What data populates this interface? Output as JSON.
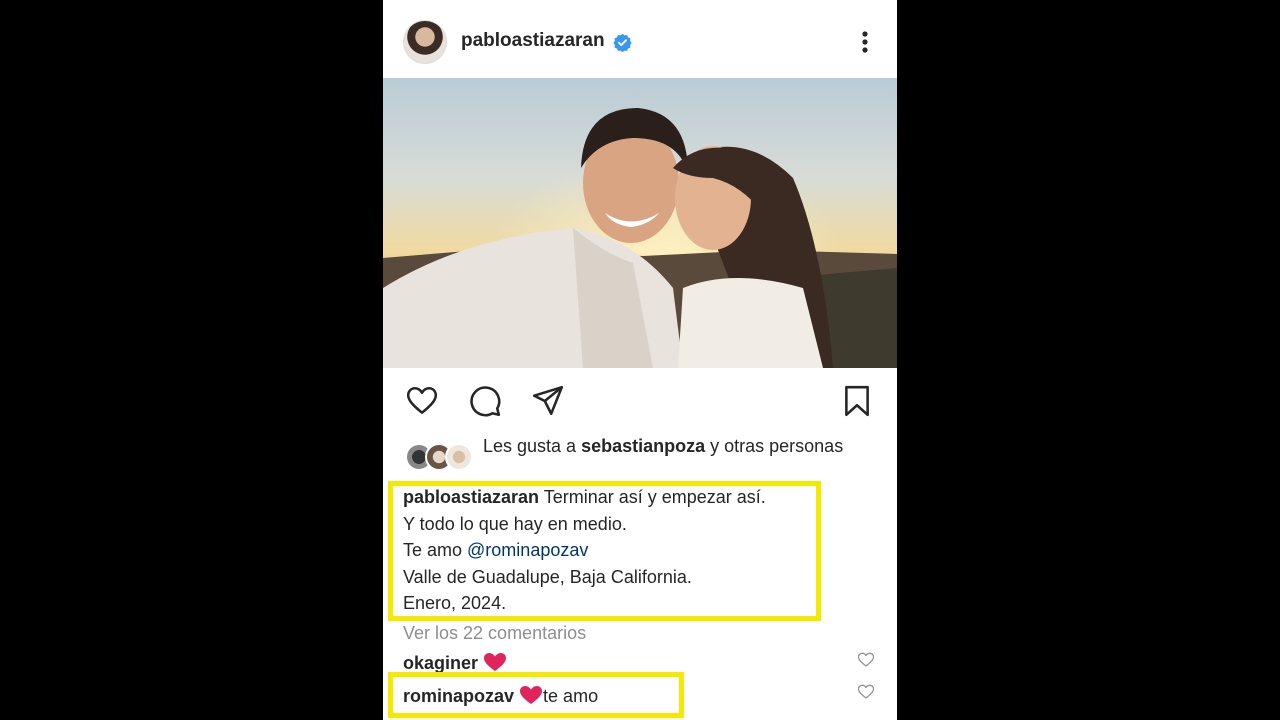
{
  "post": {
    "username": "pabloastiazaran",
    "verified": true
  },
  "likes": {
    "prefix": "Les gusta a ",
    "user": "sebastianpoza",
    "suffix": " y otras personas"
  },
  "caption": {
    "username": "pabloastiazaran",
    "line1": " Terminar así y empezar así.",
    "line2": "Y todo lo que hay en medio.",
    "line3_prefix": "Te amo ",
    "mention": "@rominapozav",
    "line4": "Valle de Guadalupe, Baja California.",
    "line5": "Enero, 2024."
  },
  "comments": {
    "view_all": "Ver los 22 comentarios",
    "items": [
      {
        "username": "okaginer",
        "text_pre": "",
        "text_post": ""
      },
      {
        "username": "rominapozav",
        "text_pre": " ",
        "text_post": "te amo"
      }
    ]
  },
  "colors": {
    "highlight": "#f5e900",
    "verified": "#3897f0",
    "mention": "#00376b",
    "heart": "#e0245e"
  },
  "icons": [
    "more-icon",
    "heart-icon",
    "comment-icon",
    "share-icon",
    "bookmark-icon",
    "verified-icon"
  ]
}
